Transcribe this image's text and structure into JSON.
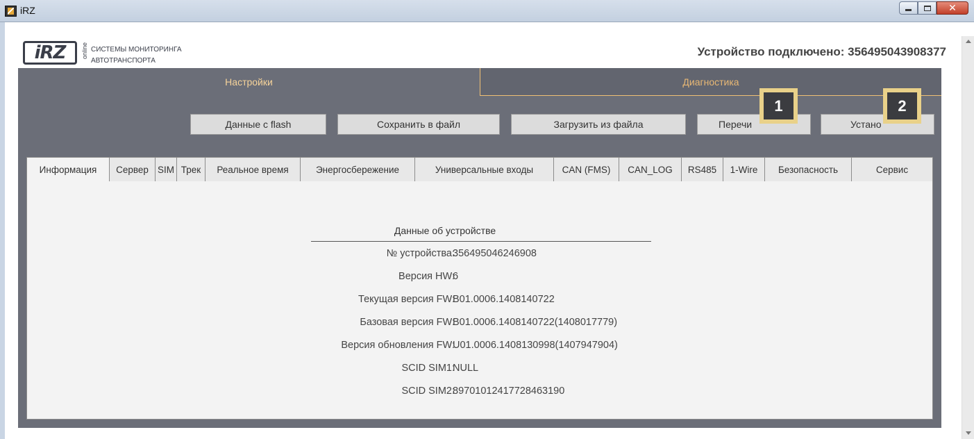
{
  "window": {
    "title": "iRZ"
  },
  "header": {
    "logo_text": "iRZ",
    "logo_online": "online",
    "logo_line1": "СИСТЕМЫ МОНИТОРИНГА",
    "logo_line2": "АВТОТРАНСПОРТА",
    "connection_status": "Устройство подключено: 356495043908377"
  },
  "main_tabs": [
    {
      "label": "Настройки",
      "active": true
    },
    {
      "label": "Диагностика",
      "active": false
    }
  ],
  "toolbar": {
    "flash_label": "Данные с flash",
    "save_label": "Сохранить в файл",
    "load_label": "Загрузить из файла",
    "reread_label": "Перечи",
    "install_label": "Устано"
  },
  "markers": [
    "1",
    "2"
  ],
  "sub_tabs": [
    {
      "label": "Информация",
      "active": true
    },
    {
      "label": "Сервер",
      "active": false
    },
    {
      "label": "SIM",
      "active": false
    },
    {
      "label": "Трек",
      "active": false
    },
    {
      "label": "Реальное время",
      "active": false
    },
    {
      "label": "Энергосбережение",
      "active": false
    },
    {
      "label": "Универсальные входы",
      "active": false
    },
    {
      "label": "CAN (FMS)",
      "active": false
    },
    {
      "label": "CAN_LOG",
      "active": false
    },
    {
      "label": "RS485",
      "active": false
    },
    {
      "label": "1-Wire",
      "active": false
    },
    {
      "label": "Безопасность",
      "active": false
    },
    {
      "label": "Сервис",
      "active": false
    }
  ],
  "device_info": {
    "title": "Данные об устройстве",
    "rows": [
      {
        "label": "№ устройства:",
        "value": "356495046246908"
      },
      {
        "label": "Версия HW:",
        "value": "6"
      },
      {
        "label": "Текущая версия FW:",
        "value": "B01.0006.1408140722"
      },
      {
        "label": "Базовая версия FW:",
        "value": "B01.0006.1408140722(1408017779)"
      },
      {
        "label": "Версия обновления FW:",
        "value": "U01.0006.1408130998(1407947904)"
      },
      {
        "label": "SCID SIM1:",
        "value": "NULL"
      },
      {
        "label": "SCID SIM2:",
        "value": "89701012417728463190"
      }
    ]
  },
  "colors": {
    "panel_bg": "#6b6e78",
    "accent_orange": "#f0c074",
    "marker_bg": "#e9d189",
    "marker_fg": "#3b3c40"
  }
}
